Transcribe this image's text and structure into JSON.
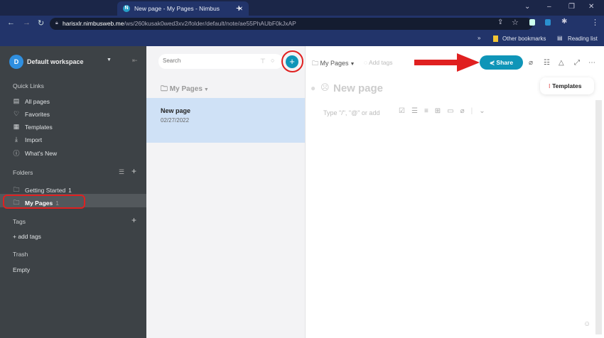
{
  "browser": {
    "tab_title": "New page - My Pages - Nimbus",
    "url_host": "harisxlr.nimbusweb.me",
    "url_path": "/ws/260kusak0wed3xv2/folder/default/note/ae55PhAUbF0kJxAP",
    "bookmarks": [
      "Other bookmarks",
      "Reading list"
    ]
  },
  "sidebar": {
    "workspace_initial": "D",
    "workspace": "Default workspace",
    "quick_links_title": "Quick Links",
    "quick_links": [
      {
        "label": "All pages",
        "icon": "page-icon"
      },
      {
        "label": "Favorites",
        "icon": "heart-icon"
      },
      {
        "label": "Templates",
        "icon": "templates-icon"
      },
      {
        "label": "Import",
        "icon": "import-icon"
      },
      {
        "label": "What's New",
        "icon": "info-icon"
      }
    ],
    "folders_title": "Folders",
    "folders": [
      {
        "label": "Getting Started",
        "count": "1"
      },
      {
        "label": "My Pages",
        "count": "1",
        "selected": true
      }
    ],
    "tags_title": "Tags",
    "add_tags": "+ add tags",
    "trash_title": "Trash",
    "trash_status": "Empty"
  },
  "list": {
    "search_placeholder": "Search",
    "folder": "My Pages",
    "items": [
      {
        "title": "New page",
        "date": "02/27/2022"
      }
    ]
  },
  "editor": {
    "breadcrumb": "My Pages",
    "add_tags": "Add tags",
    "share": "Share",
    "title_placeholder": "New page",
    "body_placeholder": "Type \"/\", \"@\" or add",
    "templates": "Templates"
  },
  "colors": {
    "accent": "#0f95b8",
    "sidebar": "#3d4246",
    "annotation": "#e02020"
  }
}
